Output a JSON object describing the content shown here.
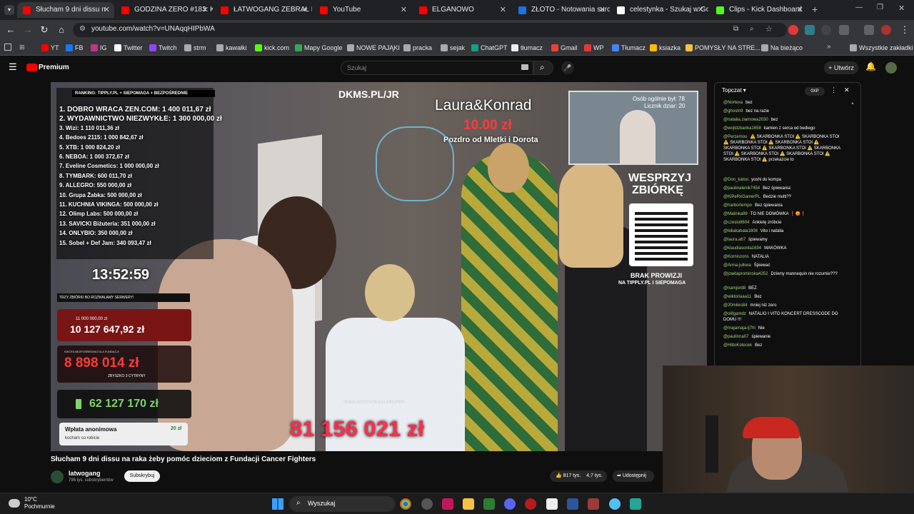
{
  "tabs": [
    {
      "label": "Słucham 9 dni dissu n",
      "color": "#ff0000",
      "active": true
    },
    {
      "label": "GODZINA ZERO #183: KF",
      "color": "#ff0000"
    },
    {
      "label": "ŁATWOGANG ZEBRAŁ PO",
      "color": "#ff0000"
    },
    {
      "label": "YouTube",
      "color": "#ff0000"
    },
    {
      "label": "ELGANOWO",
      "color": "#ff0000"
    },
    {
      "label": "ZŁOTO - Notowania suro",
      "color": "#1a73e8"
    },
    {
      "label": "celestynka - Szukaj w Go",
      "color": "#ffffff"
    },
    {
      "label": "Clips - Kick Dashboard",
      "color": "#53fc18"
    }
  ],
  "address": {
    "url": "youtube.com/watch?v=UNAqqHIPbWA"
  },
  "bookmarks": [
    "YT",
    "FB",
    "IG",
    "Twitter",
    "Twitch",
    "strm",
    "kawałki",
    "kick.com",
    "Mapy Google",
    "NOWE PAJĄKI",
    "pracka",
    "sejak",
    "ChatGPT",
    "tłumacz",
    "Gmail",
    "WP",
    "Tłumacz",
    "ksiazka",
    "POMYSŁY NA STRE...",
    "Na bieżąco",
    "Wszystkie zakładki"
  ],
  "yt": {
    "logo": "Premium",
    "search_placeholder": "Szukaj",
    "create_label": "Utwórz"
  },
  "overlay": {
    "ranking_header": "RANKING:  TIPPLY.PL + SIEPOMAGA + BEZPOŚREDNIE",
    "ranking": [
      "1. DOBRO WRACA ZEN.COM: 1 400 011,67 zł",
      "2. WYDAWNICTWO NIEZWYKŁE: 1 300 000,00 zł",
      "3. Wizi: 1 110 011,36 zł",
      "4. Bedoes 2115: 1 000 842,67 zł",
      "5. XTB: 1 000 824,20 zł",
      "6. NEBOA: 1 000 372,67 zł",
      "7. Eveline Cosmetics: 1 000 000,00 zł",
      "8. TYMBARK: 600 011,70 zł",
      "9. ALLEGRO: 550 000,00 zł",
      "10. Grupa Żabka: 500 000,00 zł",
      "11. KUCHNIA VIKINGA: 500 000,00 zł",
      "12. Olimp Labs: 500 000,00 zł",
      "13. SAVICKI Biżuteria: 351 000,00 zł",
      "14. ONLYBIO: 350 000,00 zł",
      "15. Sobel + Def Jam: 340 093,47 zł"
    ],
    "timer": "13:52:59",
    "dkms": "DKMS.PL/JR",
    "donor_name": "Laura&Konrad",
    "donor_amount": "10.00 zł",
    "donor_msg": "Pozdro od Mletki i Dorota",
    "zbiorki_label": "TRZY ZBIÓRKI BO ROZWALAMY SERWERY!",
    "goal1_top": "11 000 000,00 zł",
    "goal1": "10 127 647,92 zł",
    "goal2_label": "KWOTA BEZPOŚREDNIO DLA FUNDACJI",
    "goal2": "8 898 014 zł",
    "goal2_sub": "ZBYSZKO 3 CYTRYNY",
    "goal3": "62 127 170 zł",
    "anon_title": "Wpłata anonimowa",
    "anon_amount": "20 zł",
    "anon_msg": "kocham co robicie",
    "wesprzyj1": "WESPRZYJ",
    "wesprzyj2": "ZBIÓRKĘ",
    "brak1": "BRAK PROWIZJI",
    "brak2": "NA TIPPLY.PL I SIEPOMAGA",
    "total_label": "SUMA WSZYSTKICH ZBIÓREK",
    "total": "81 156 021 zł",
    "inset_line1": "Osób ogólnie był: 78",
    "inset_line2": "Licznik dziar: 20"
  },
  "chat": {
    "mode": "Topczat",
    "points": "0XP",
    "messages": [
      {
        "u": "@Nortexa",
        "t": "bez"
      },
      {
        "u": "@ghostn9",
        "t": "bez na razie"
      },
      {
        "u": "@natalia.ziarnowa2030",
        "t": "bez"
      },
      {
        "u": "@wojtdzbanka1658",
        "t": "kamien z serca od bediego"
      },
      {
        "u": "@Perzemou",
        "t": "⚠️ SKARBONKA STOI ⚠️ SKARBONKA STOI ⚠️ SKARBONKA STOI ⚠️ SKARBONKA STOI ⚠️ SKARBONKA STOI ⚠️ SKARBONKA STOI ⚠️ SKARBONKA STOI ⚠️ SKARBONKA STOI ⚠️ SKARBONKA STOI ⚠️ SKARBONKA STOI ⚠️ przekażcie to"
      },
      {
        "u": "@Don_katoo",
        "t": "yoshi do kompa"
      },
      {
        "u": "@paulinalenik7454",
        "t": "Bez śpiewania"
      },
      {
        "u": "@KiPeRxGamerPL",
        "t": "Bedzie multi??"
      },
      {
        "u": "@harbortempo",
        "t": "Bez śpiewania"
      },
      {
        "u": "@Matinka99",
        "t": "TO NIE DOMÓWKA ❗😡❗"
      },
      {
        "u": "@czesio8604",
        "t": "Ankietę zróbcie"
      },
      {
        "u": "@lidiakabala1808",
        "t": "Vito i natalia"
      },
      {
        "u": "@laura.a67",
        "t": "śpiewamy"
      },
      {
        "u": "@klaudiasonta1694",
        "t": "MAKÓWKA"
      },
      {
        "u": "@Korniszons",
        "t": "NATALIA"
      },
      {
        "u": "@Anna-julkwa",
        "t": "Śpiewać"
      },
      {
        "u": "@jowitaprominska4252",
        "t": "Dziwny mannequin nie rozumie???"
      },
      {
        "u": "@namjord8",
        "t": "BEZ"
      },
      {
        "u": "@wiktoriaaa11",
        "t": "Bez"
      },
      {
        "u": "@20miles84",
        "t": "mniej niż zero"
      },
      {
        "u": "@olifgamdz",
        "t": "NATALIO I VITO KONCERT DRESSCODE DO DOMU !!!"
      },
      {
        "u": "@majamaja-lj7hl",
        "t": "Nie"
      },
      {
        "u": "@paulinna07",
        "t": "śpiewanie"
      },
      {
        "u": "@HittoKotecek",
        "t": "Bez"
      }
    ]
  },
  "video": {
    "title": "Słucham 9 dni dissu na raka żeby pomóc dzieciom z Fundacji Cancer Fighters",
    "channel": "latwogang",
    "subs": "796 tys. subskrybentów",
    "subscribe": "Subskrybuj",
    "likes": "817 tys.",
    "likes2": "4,7 tys.",
    "share": "Udostępnij"
  },
  "taskbar": {
    "weather_temp": "10°C",
    "weather_desc": "Pochmurnie",
    "search": "Wyszukaj"
  }
}
